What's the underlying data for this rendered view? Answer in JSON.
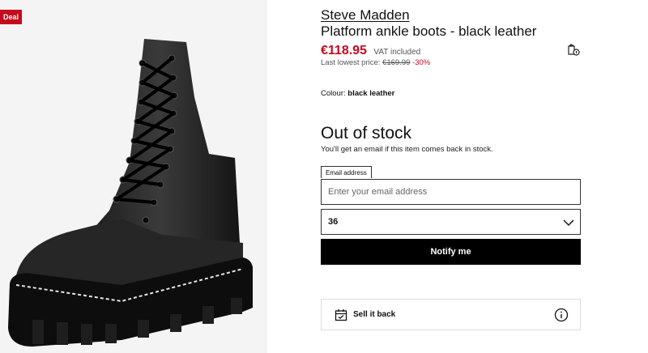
{
  "badge": {
    "text": "Deal",
    "color": "#c60a1d"
  },
  "product": {
    "brand": "Steve Madden",
    "name": "Platform ankle boots - black leather",
    "price": "€118.95",
    "vat": "VAT included",
    "lowest_prefix": "Last lowest price: ",
    "lowest_price": "€169.99",
    "discount": "-30%",
    "colour_label": "Colour:",
    "colour_value": "black leather"
  },
  "stock": {
    "title": "Out of stock",
    "description": "You'll get an email if this item comes back in stock."
  },
  "form": {
    "email_label": "Email address",
    "email_placeholder": "Enter your email address",
    "email_value": "",
    "size_value": "36",
    "notify_label": "Notify me"
  },
  "sell": {
    "label": "Sell it back"
  },
  "icons": {
    "size_guide": "size-guide-icon",
    "chevron": "chevron-down-icon",
    "calendar": "calendar-icon",
    "info": "info-icon"
  },
  "colors": {
    "accent": "#c60a1d",
    "button_bg": "#000000"
  }
}
